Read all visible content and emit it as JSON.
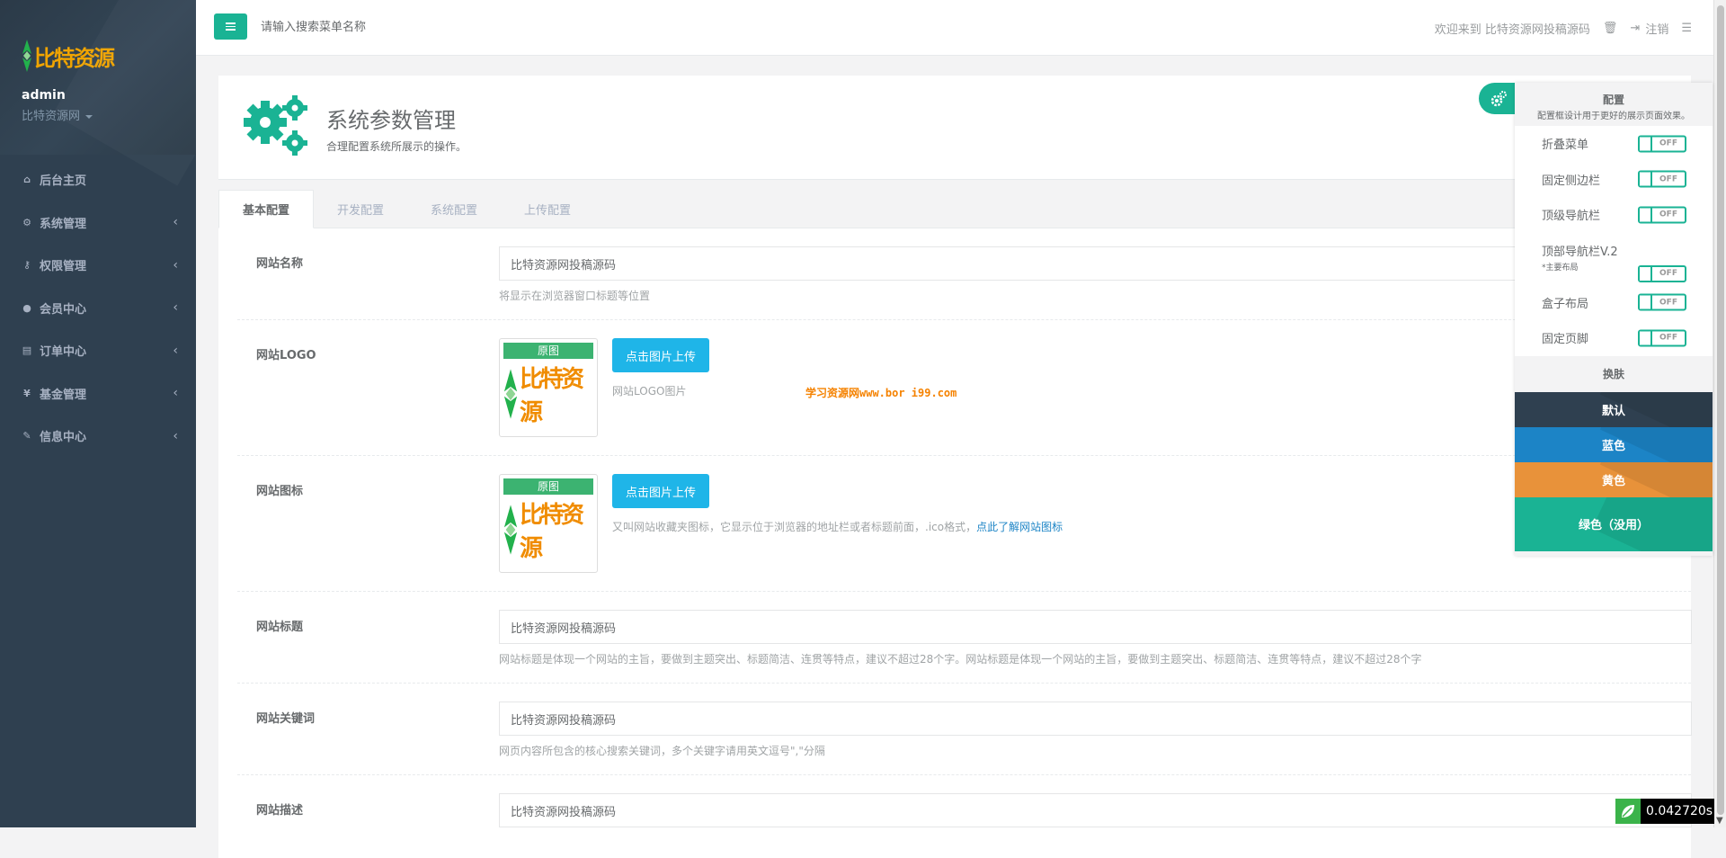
{
  "sidebar": {
    "logo_text": "比特资源",
    "user_name": "admin",
    "user_site": "比特资源网",
    "items": [
      {
        "label": "后台主页",
        "icon": "home-icon"
      },
      {
        "label": "系统管理",
        "icon": "gears-icon"
      },
      {
        "label": "权限管理",
        "icon": "key-icon"
      },
      {
        "label": "会员中心",
        "icon": "user-icon"
      },
      {
        "label": "订单中心",
        "icon": "list-icon"
      },
      {
        "label": "基金管理",
        "icon": "yen-icon"
      },
      {
        "label": "信息中心",
        "icon": "wrench-icon"
      }
    ]
  },
  "topbar": {
    "search_placeholder": "请输入搜索菜单名称",
    "welcome": "欢迎来到 比特资源网投稿源码",
    "logout": "注销"
  },
  "header": {
    "title": "系统参数管理",
    "subtitle": "合理配置系统所展示的操作。"
  },
  "tabs": [
    {
      "label": "基本配置",
      "active": true
    },
    {
      "label": "开发配置",
      "active": false
    },
    {
      "label": "系统配置",
      "active": false
    },
    {
      "label": "上传配置",
      "active": false
    }
  ],
  "form": {
    "site_name": {
      "label": "网站名称",
      "value": "比特资源网投稿源码",
      "help": "将显示在浏览器窗口标题等位置"
    },
    "site_logo": {
      "label": "网站LOGO",
      "tag": "原图",
      "preview_text": "比特资源",
      "button": "点击图片上传",
      "help": "网站LOGO图片"
    },
    "site_icon": {
      "label": "网站图标",
      "tag": "原图",
      "preview_text": "比特资源",
      "button": "点击图片上传",
      "help": "又叫网站收藏夹图标，它显示位于浏览器的地址栏或者标题前面，.ico格式，",
      "help_link": "点此了解网站图标"
    },
    "site_title": {
      "label": "网站标题",
      "value": "比特资源网投稿源码",
      "help": "网站标题是体现一个网站的主旨，要做到主题突出、标题简洁、连贯等特点，建议不超过28个字。网站标题是体现一个网站的主旨，要做到主题突出、标题简洁、连贯等特点，建议不超过28个字"
    },
    "site_keywords": {
      "label": "网站关键词",
      "value": "比特资源网投稿源码",
      "help": "网页内容所包含的核心搜索关键词，多个关键字请用英文逗号\",\"分隔"
    },
    "site_desc": {
      "label": "网站描述",
      "value": "比特资源网投稿源码"
    }
  },
  "watermark": "学习资源网www.bor i99.com",
  "config": {
    "title": "配置",
    "desc": "配置框设计用于更好的展示页面效果。",
    "switch_text": "OFF",
    "options": [
      {
        "label": "折叠菜单"
      },
      {
        "label": "固定侧边栏"
      },
      {
        "label": "顶级导航栏"
      },
      {
        "label": "顶部导航栏V.2",
        "sub": "*主要布局"
      },
      {
        "label": "盒子布局"
      },
      {
        "label": "固定页脚"
      }
    ],
    "skin_title": "换肤",
    "skins": {
      "default": "默认",
      "blue": "蓝色",
      "yellow": "黄色",
      "green": "绿色（没用）"
    }
  },
  "timer": "0.042720s",
  "colors": {
    "sidebar_bg": "#2f4050",
    "accent": "#1ab394",
    "upload_button": "#1fb5e8",
    "link": "#1c84c6"
  }
}
